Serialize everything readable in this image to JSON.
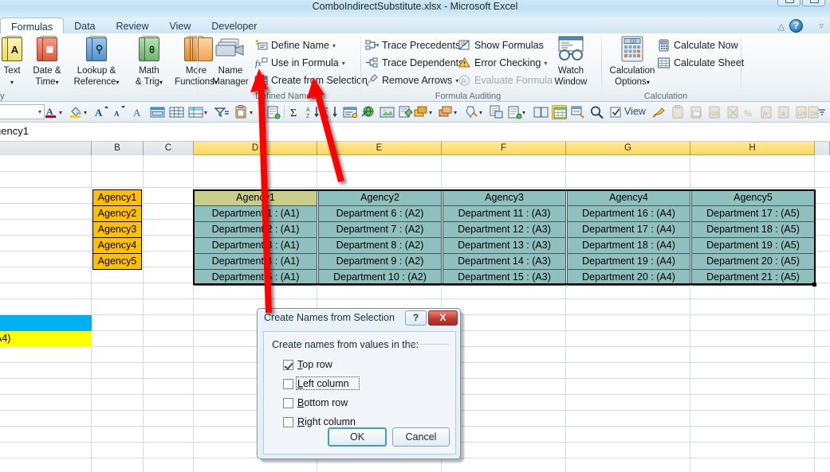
{
  "window": {
    "title": "ComboIndirectSubstitute.xlsx  -  Microsoft Excel",
    "restore_label": "restore",
    "minimize_label": "minimize"
  },
  "tabs": [
    {
      "label": "Formulas",
      "active": true
    },
    {
      "label": "Data",
      "active": false
    },
    {
      "label": "Review",
      "active": false
    },
    {
      "label": "View",
      "active": false
    },
    {
      "label": "Developer",
      "active": false
    }
  ],
  "help": {
    "home_icon": "home-icon",
    "help_icon": "help-icon",
    "collapse_icon": "chevron-down-icon"
  },
  "ribbon": {
    "groups": [
      {
        "name": "function-library",
        "label": "Library",
        "big_buttons": [
          {
            "label1": "Text",
            "label2": "",
            "glyph": "A",
            "color": "#f2e96b",
            "caret": true
          },
          {
            "label1": "Date &",
            "label2": "Time",
            "glyph": "☷",
            "color": "#e8583c",
            "caret": true
          },
          {
            "label1": "Lookup &",
            "label2": "Reference",
            "glyph": "⌕",
            "color": "#5d9ed6",
            "caret": true
          },
          {
            "label1": "Math",
            "label2": "& Trig",
            "glyph": "θ",
            "color": "#7fbf7f",
            "caret": true
          },
          {
            "label1": "More",
            "label2": "Functions",
            "glyph": "",
            "color": "#f0a33c",
            "caret": true
          }
        ]
      },
      {
        "name": "defined-names",
        "label": "Defined Names",
        "big_buttons": [
          {
            "label1": "Name",
            "label2": "Manager",
            "glyph": "",
            "color": "#b9c4d2",
            "caret": false
          }
        ],
        "small_commands": [
          {
            "label": "Define Name",
            "icon": "define-name-icon",
            "caret": true,
            "disabled": false
          },
          {
            "label": "Use in Formula",
            "icon": "fx-icon",
            "caret": true,
            "disabled": false
          },
          {
            "label": "Create from Selection",
            "icon": "create-from-selection-icon",
            "caret": false,
            "disabled": false
          }
        ]
      },
      {
        "name": "formula-auditing",
        "label": "Formula Auditing",
        "small_commands_col1": [
          {
            "label": "Trace Precedents",
            "icon": "trace-precedents-icon",
            "caret": false,
            "disabled": false
          },
          {
            "label": "Trace Dependents",
            "icon": "trace-dependents-icon",
            "caret": false,
            "disabled": false
          },
          {
            "label": "Remove Arrows",
            "icon": "remove-arrows-icon",
            "caret": true,
            "disabled": false
          }
        ],
        "small_commands_col2": [
          {
            "label": "Show Formulas",
            "icon": "show-formulas-icon",
            "caret": false,
            "disabled": false
          },
          {
            "label": "Error Checking",
            "icon": "error-checking-icon",
            "caret": true,
            "disabled": false
          },
          {
            "label": "Evaluate Formula",
            "icon": "evaluate-formula-icon",
            "caret": false,
            "disabled": true
          }
        ],
        "watch_window": {
          "label1": "Watch",
          "label2": "Window",
          "icon": "watch-window-icon"
        }
      },
      {
        "name": "calculation",
        "label": "Calculation",
        "calc_options": {
          "label1": "Calculation",
          "label2": "Options",
          "icon": "calculation-options-icon",
          "caret": true
        },
        "small_commands": [
          {
            "label": "Calculate Now",
            "icon": "calculate-now-icon",
            "caret": false,
            "disabled": false
          },
          {
            "label": "Calculate Sheet",
            "icon": "calculate-sheet-icon",
            "caret": false,
            "disabled": false
          }
        ]
      }
    ]
  },
  "quick_toolbar": {
    "font_name_value": "i",
    "view_label": "View",
    "icons": [
      "font-color-icon",
      "fill-color-icon",
      "increase-font-icon",
      "decrease-font-icon",
      "font-style-icon",
      "merge-cells-icon",
      "borders-grid-icon",
      "border-style-icon",
      "filter-icon",
      "paste-special-icon",
      "export-icon",
      "autosum-icon",
      "sort-az-icon",
      "sort-za-icon",
      "form-icon",
      "hyperlink-icon",
      "picture-icon",
      "insert-object-icon",
      "shape-icon",
      "shape-fill-icon",
      "shape-outline-icon",
      "print-preview-icon",
      "page-setup-icon",
      "book-icon",
      "spreadsheet-icon",
      "find-replace-icon",
      "zoom-icon",
      "checkbox-view-icon",
      "format-painter-icon",
      "paste-values-icon",
      "paste-formulas-icon",
      "paste-link-icon",
      "paste-noborder-icon",
      "percent-icon",
      "formula-paste-icon",
      "paste-text-icon",
      "paste-number-icon",
      "paste-percent-icon",
      "paste-decimal-icon",
      "more-icon"
    ]
  },
  "formula_bar": {
    "value": "gency1"
  },
  "sheet": {
    "column_headers": [
      {
        "label": "",
        "selected": false
      },
      {
        "label": "B",
        "selected": false
      },
      {
        "label": "C",
        "selected": false
      },
      {
        "label": "D",
        "selected": true
      },
      {
        "label": "E",
        "selected": true
      },
      {
        "label": "F",
        "selected": true
      },
      {
        "label": "G",
        "selected": true
      },
      {
        "label": "H",
        "selected": true
      },
      {
        "label": "",
        "selected": false
      }
    ],
    "agency_list": [
      "Agency1",
      "Agency2",
      "Agency3",
      "Agency4",
      "Agency5"
    ],
    "table": {
      "headers": [
        "Agency1",
        "Agency2",
        "Agency3",
        "Agency4",
        "Agency5"
      ],
      "rows": [
        [
          "Department 1 : (A1)",
          "Department 6 : (A2)",
          "Department 11 : (A3)",
          "Department 16 : (A4)",
          "Department 17 : (A5)"
        ],
        [
          "Department 2 : (A1)",
          "Department 7 : (A2)",
          "Department 12 : (A3)",
          "Department 17 : (A4)",
          "Department 18 : (A5)"
        ],
        [
          "Department 3 : (A1)",
          "Department 8 : (A2)",
          "Department 13 : (A3)",
          "Department 18 : (A4)",
          "Department 19 : (A5)"
        ],
        [
          "Department 4 : (A1)",
          "Department 9 : (A2)",
          "Department 14 : (A3)",
          "Department 19 : (A4)",
          "Department 20 : (A5)"
        ],
        [
          "Department 5 : (A1)",
          "Department 10 : (A2)",
          "Department 15 : (A3)",
          "Department 20 : (A4)",
          "Department 21 : (A5)"
        ]
      ]
    },
    "highlight_cells": [
      {
        "name": "cyan-cell",
        "text": "",
        "color": "#00b0f0"
      },
      {
        "name": "yellow-cell",
        "text": "A4)",
        "color": "#ffff00"
      }
    ]
  },
  "dialog": {
    "title": "Create Names from Selection",
    "help_button": "?",
    "close_button": "X",
    "group_label": "Create names from values in the:",
    "checkboxes": [
      {
        "label": "Top row",
        "accel": "T",
        "checked": true,
        "focused": false
      },
      {
        "label": "Left column",
        "accel": "L",
        "checked": false,
        "focused": true
      },
      {
        "label": "Bottom row",
        "accel": "B",
        "checked": false,
        "focused": false
      },
      {
        "label": "Right column",
        "accel": "R",
        "checked": false,
        "focused": false
      }
    ],
    "ok_label": "OK",
    "cancel_label": "Cancel"
  },
  "annotations": {
    "arrow_color": "#ff0000",
    "arrows": [
      {
        "name": "arrow-to-create-from-selection"
      },
      {
        "name": "arrow-to-ribbon-command"
      }
    ]
  }
}
